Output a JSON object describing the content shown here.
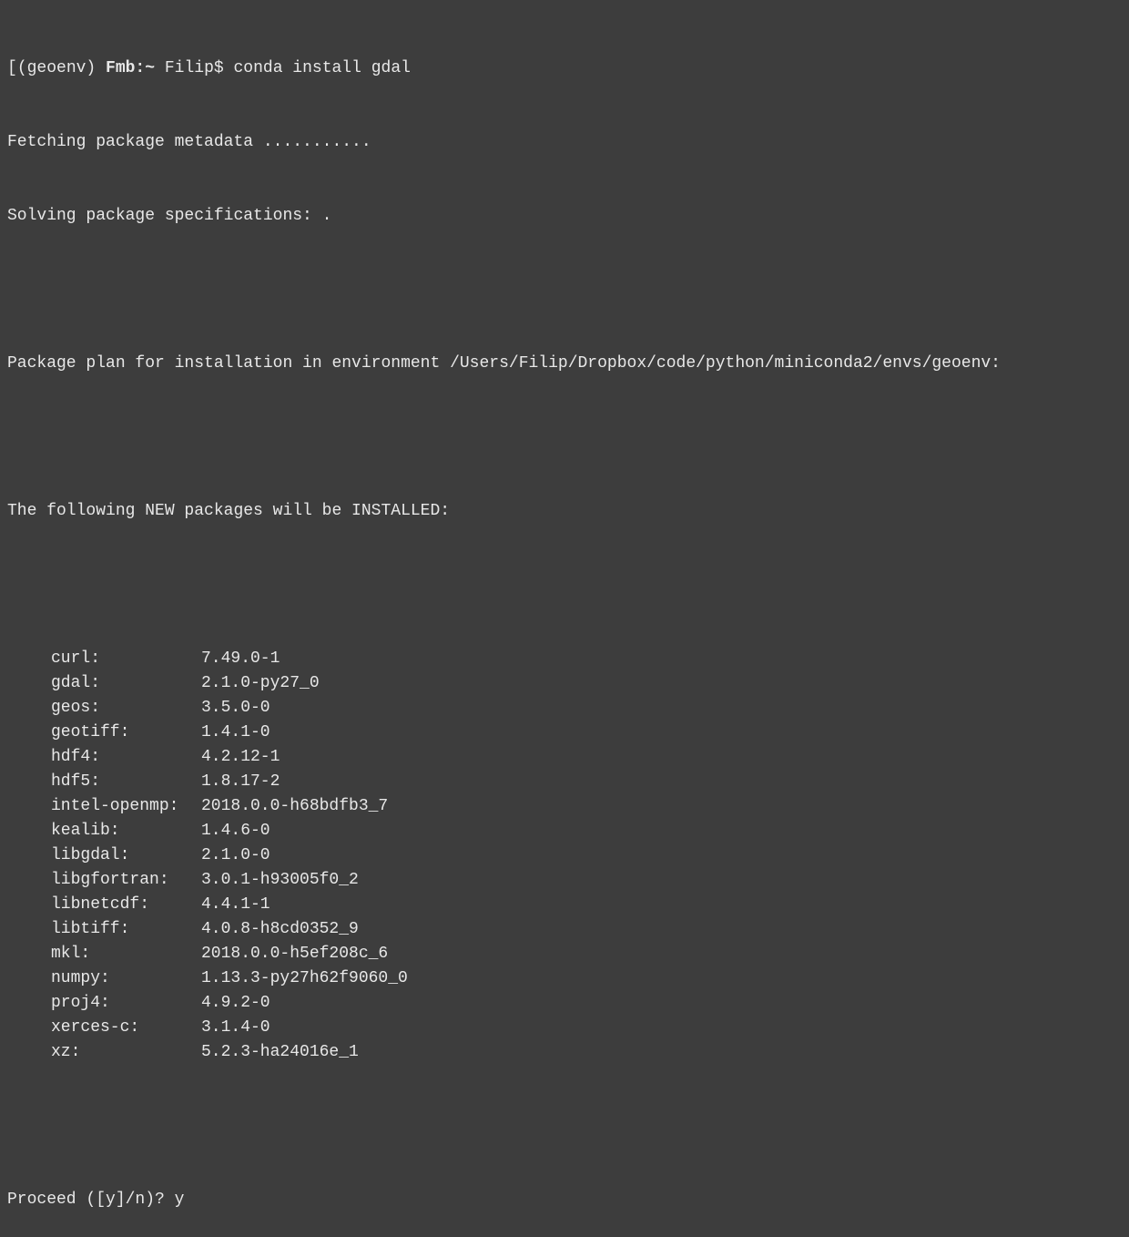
{
  "prompt": {
    "bracket_open": "[",
    "env": "(geoenv) ",
    "host": "Fmb:",
    "path": "~ ",
    "user": "Filip$ ",
    "command": "conda install gdal"
  },
  "fetching_line": "Fetching package metadata ...........",
  "solving_line": "Solving package specifications: .",
  "plan_line": "Package plan for installation in environment /Users/Filip/Dropbox/code/python/miniconda2/envs/geoenv:",
  "new_packages_line": "The following NEW packages will be INSTALLED:",
  "packages": [
    {
      "name": "curl:",
      "version": "7.49.0-1"
    },
    {
      "name": "gdal:",
      "version": "2.1.0-py27_0"
    },
    {
      "name": "geos:",
      "version": "3.5.0-0"
    },
    {
      "name": "geotiff:",
      "version": "1.4.1-0"
    },
    {
      "name": "hdf4:",
      "version": "4.2.12-1"
    },
    {
      "name": "hdf5:",
      "version": "1.8.17-2"
    },
    {
      "name": "intel-openmp:",
      "version": "2018.0.0-h68bdfb3_7"
    },
    {
      "name": "kealib:",
      "version": "1.4.6-0"
    },
    {
      "name": "libgdal:",
      "version": "2.1.0-0"
    },
    {
      "name": "libgfortran:",
      "version": "3.0.1-h93005f0_2"
    },
    {
      "name": "libnetcdf:",
      "version": "4.4.1-1"
    },
    {
      "name": "libtiff:",
      "version": "4.0.8-h8cd0352_9"
    },
    {
      "name": "mkl:",
      "version": "2018.0.0-h5ef208c_6"
    },
    {
      "name": "numpy:",
      "version": "1.13.3-py27h62f9060_0"
    },
    {
      "name": "proj4:",
      "version": "4.9.2-0"
    },
    {
      "name": "xerces-c:",
      "version": "3.1.4-0"
    },
    {
      "name": "xz:",
      "version": "5.2.3-ha24016e_1"
    }
  ],
  "proceed_prompt": "Proceed ([y]/n)? ",
  "proceed_answer": "y"
}
